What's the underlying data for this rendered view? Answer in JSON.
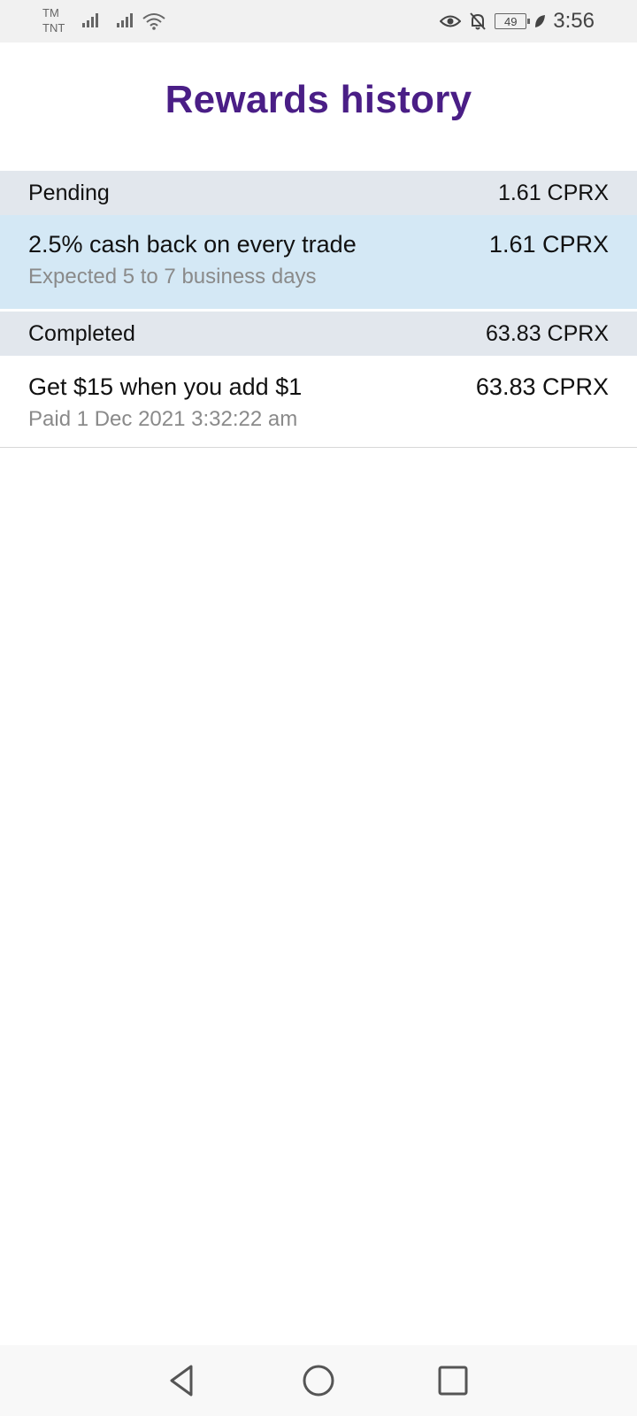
{
  "status_bar": {
    "carrier_1": "TM",
    "carrier_2": "TNT",
    "battery": "49",
    "time": "3:56",
    "icons": [
      "signal-icon",
      "wifi-icon",
      "eye-icon",
      "bell-off-icon",
      "battery-icon",
      "leaf-icon"
    ]
  },
  "page": {
    "title": "Rewards history"
  },
  "pending": {
    "label": "Pending",
    "total": "1.61 CPRX",
    "items": [
      {
        "title": "2.5% cash back on every trade",
        "subtitle": "Expected 5 to 7 business days",
        "amount": "1.61 CPRX"
      }
    ]
  },
  "completed": {
    "label": "Completed",
    "total": "63.83 CPRX",
    "items": [
      {
        "title": "Get $15 when you add $1",
        "subtitle": "Paid 1 Dec 2021 3:32:22 am",
        "amount": "63.83 CPRX"
      }
    ]
  },
  "nav_bar": {
    "icons": [
      "back-icon",
      "home-icon",
      "recents-icon"
    ]
  },
  "colors": {
    "title": "#4a1e86",
    "section_header_bg": "#e2e7ed",
    "pending_row_bg": "#d4e8f5"
  }
}
